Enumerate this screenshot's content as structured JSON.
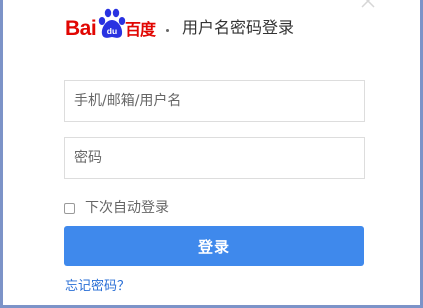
{
  "logo": {
    "latin_text": "Bai",
    "paw_text": "du",
    "cn_text": "百度",
    "brand_color": "#e10602"
  },
  "header": {
    "title": "用户名密码登录"
  },
  "form": {
    "username_placeholder": "手机/邮箱/用户名",
    "password_placeholder": "密码",
    "remember_label": "下次自动登录",
    "remember_checked": false,
    "submit_label": "登录",
    "forgot_label": "忘记密码？"
  },
  "icons": {
    "close": "close-icon",
    "logo": "baidu-paw-icon"
  },
  "colors": {
    "primary_button": "#3f89ec",
    "link": "#2a6fd6",
    "frame_border": "#7c93c8"
  }
}
